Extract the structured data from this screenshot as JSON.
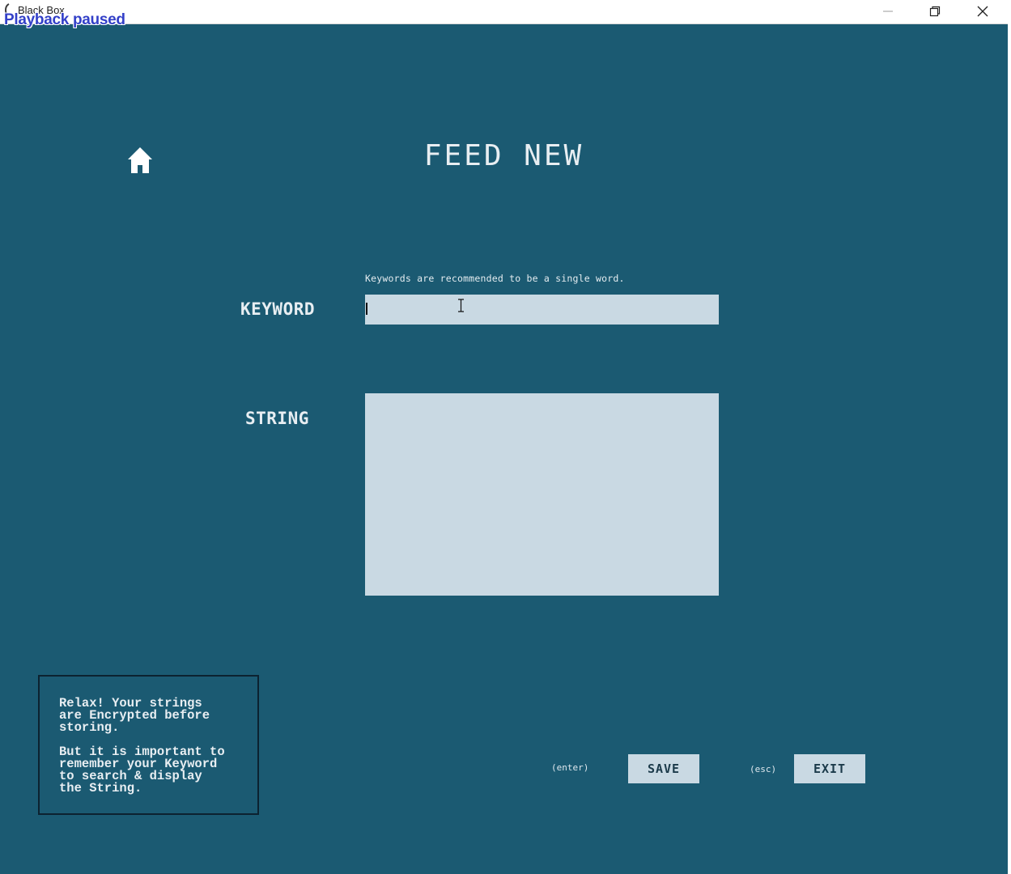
{
  "window": {
    "title": "Black Box",
    "overlay_text": "Playback paused"
  },
  "page": {
    "title": "FEED NEW",
    "home_icon": "home-icon"
  },
  "form": {
    "keyword_hint": "Keywords are recommended to be a single word.",
    "keyword_label": "KEYWORD",
    "keyword_value": "",
    "string_label": "STRING",
    "string_value": ""
  },
  "info": {
    "line1": "Relax! Your strings\nare Encrypted before\nstoring.",
    "line2": "But it is important to\nremember your Keyword\nto search & display\nthe String."
  },
  "actions": {
    "save_shortcut": "(enter)",
    "save_label": "SAVE",
    "exit_shortcut": "(esc)",
    "exit_label": "EXIT"
  },
  "colors": {
    "background": "#1b5a72",
    "field": "#c9d9e3",
    "text": "#e8eef2"
  }
}
